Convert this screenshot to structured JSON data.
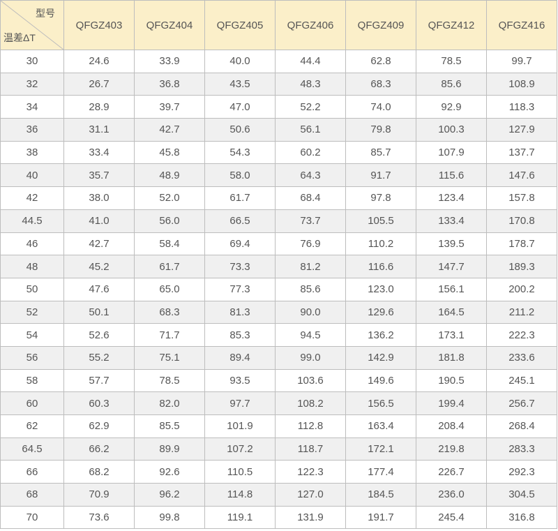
{
  "header": {
    "corner_top": "型号",
    "corner_bottom": "温差ΔT",
    "models": [
      "QFGZ403",
      "QFGZ404",
      "QFGZ405",
      "QFGZ406",
      "QFGZ409",
      "QFGZ412",
      "QFGZ416"
    ]
  },
  "rows": [
    [
      "30",
      "24.6",
      "33.9",
      "40.0",
      "44.4",
      "62.8",
      "78.5",
      "99.7"
    ],
    [
      "32",
      "26.7",
      "36.8",
      "43.5",
      "48.3",
      "68.3",
      "85.6",
      "108.9"
    ],
    [
      "34",
      "28.9",
      "39.7",
      "47.0",
      "52.2",
      "74.0",
      "92.9",
      "118.3"
    ],
    [
      "36",
      "31.1",
      "42.7",
      "50.6",
      "56.1",
      "79.8",
      "100.3",
      "127.9"
    ],
    [
      "38",
      "33.4",
      "45.8",
      "54.3",
      "60.2",
      "85.7",
      "107.9",
      "137.7"
    ],
    [
      "40",
      "35.7",
      "48.9",
      "58.0",
      "64.3",
      "91.7",
      "115.6",
      "147.6"
    ],
    [
      "42",
      "38.0",
      "52.0",
      "61.7",
      "68.4",
      "97.8",
      "123.4",
      "157.8"
    ],
    [
      "44.5",
      "41.0",
      "56.0",
      "66.5",
      "73.7",
      "105.5",
      "133.4",
      "170.8"
    ],
    [
      "46",
      "42.7",
      "58.4",
      "69.4",
      "76.9",
      "110.2",
      "139.5",
      "178.7"
    ],
    [
      "48",
      "45.2",
      "61.7",
      "73.3",
      "81.2",
      "116.6",
      "147.7",
      "189.3"
    ],
    [
      "50",
      "47.6",
      "65.0",
      "77.3",
      "85.6",
      "123.0",
      "156.1",
      "200.2"
    ],
    [
      "52",
      "50.1",
      "68.3",
      "81.3",
      "90.0",
      "129.6",
      "164.5",
      "211.2"
    ],
    [
      "54",
      "52.6",
      "71.7",
      "85.3",
      "94.5",
      "136.2",
      "173.1",
      "222.3"
    ],
    [
      "56",
      "55.2",
      "75.1",
      "89.4",
      "99.0",
      "142.9",
      "181.8",
      "233.6"
    ],
    [
      "58",
      "57.7",
      "78.5",
      "93.5",
      "103.6",
      "149.6",
      "190.5",
      "245.1"
    ],
    [
      "60",
      "60.3",
      "82.0",
      "97.7",
      "108.2",
      "156.5",
      "199.4",
      "256.7"
    ],
    [
      "62",
      "62.9",
      "85.5",
      "101.9",
      "112.8",
      "163.4",
      "208.4",
      "268.4"
    ],
    [
      "64.5",
      "66.2",
      "89.9",
      "107.2",
      "118.7",
      "172.1",
      "219.8",
      "283.3"
    ],
    [
      "66",
      "68.2",
      "92.6",
      "110.5",
      "122.3",
      "177.4",
      "226.7",
      "292.3"
    ],
    [
      "68",
      "70.9",
      "96.2",
      "114.8",
      "127.0",
      "184.5",
      "236.0",
      "304.5"
    ],
    [
      "70",
      "73.6",
      "99.8",
      "119.1",
      "131.9",
      "191.7",
      "245.4",
      "316.8"
    ]
  ]
}
